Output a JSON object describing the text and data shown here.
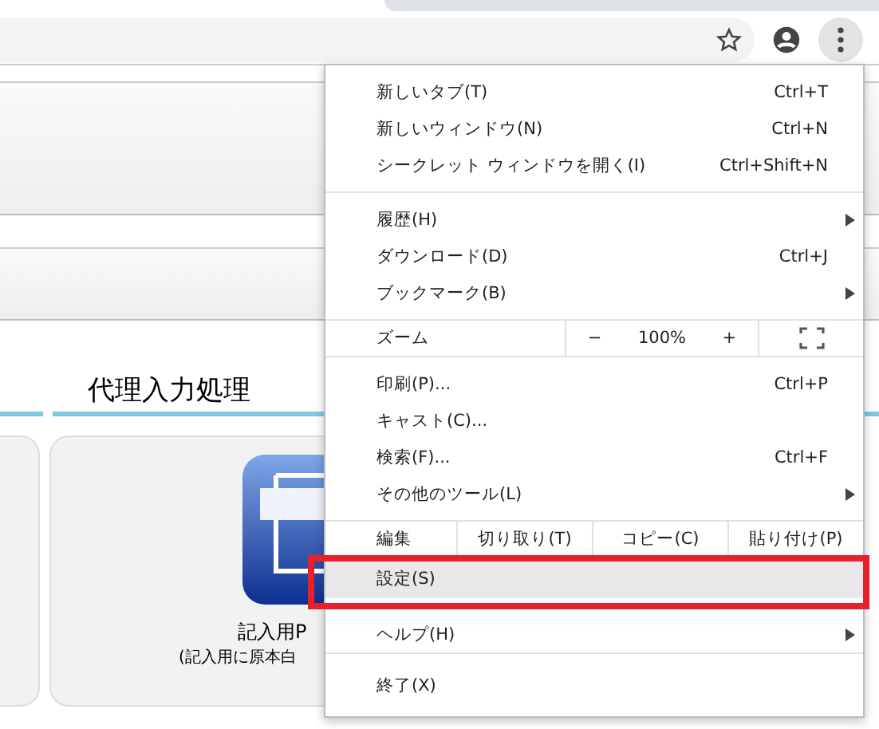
{
  "page": {
    "heading": "代理入力処理",
    "card": {
      "title": "記入用P",
      "subtitle": "(記入用に原本白"
    }
  },
  "menu": {
    "sections": [
      [
        {
          "kind": "item",
          "label": "新しいタブ(T)",
          "shortcut": "Ctrl+T",
          "submenu": false,
          "selected": false
        },
        {
          "kind": "item",
          "label": "新しいウィンドウ(N)",
          "shortcut": "Ctrl+N",
          "submenu": false,
          "selected": false
        },
        {
          "kind": "item",
          "label": "シークレット ウィンドウを開く(I)",
          "shortcut": "Ctrl+Shift+N",
          "submenu": false,
          "selected": false
        }
      ],
      [
        {
          "kind": "item",
          "label": "履歴(H)",
          "submenu": true,
          "selected": false
        },
        {
          "kind": "item",
          "label": "ダウンロード(D)",
          "shortcut": "Ctrl+J",
          "submenu": false,
          "selected": false
        },
        {
          "kind": "item",
          "label": "ブックマーク(B)",
          "submenu": true,
          "selected": false
        }
      ],
      [
        {
          "kind": "zoom",
          "label": "ズーム",
          "minus": "−",
          "value": "100%",
          "plus": "+"
        }
      ],
      [
        {
          "kind": "item",
          "label": "印刷(P)...",
          "shortcut": "Ctrl+P",
          "submenu": false,
          "selected": false
        },
        {
          "kind": "item",
          "label": "キャスト(C)...",
          "submenu": false,
          "selected": false
        },
        {
          "kind": "item",
          "label": "検索(F)...",
          "shortcut": "Ctrl+F",
          "submenu": false,
          "selected": false
        },
        {
          "kind": "item",
          "label": "その他のツール(L)",
          "submenu": true,
          "selected": false
        }
      ],
      [
        {
          "kind": "edit",
          "label": "編集",
          "buttons": [
            "切り取り(T)",
            "コピー(C)",
            "貼り付け(P)"
          ]
        },
        {
          "kind": "item",
          "label": "設定(S)",
          "submenu": false,
          "selected": true
        },
        {
          "kind": "item",
          "label": "ヘルプ(H)",
          "submenu": true,
          "selected": false
        }
      ],
      [
        {
          "kind": "item",
          "label": "終了(X)",
          "submenu": false,
          "selected": false
        }
      ]
    ]
  }
}
